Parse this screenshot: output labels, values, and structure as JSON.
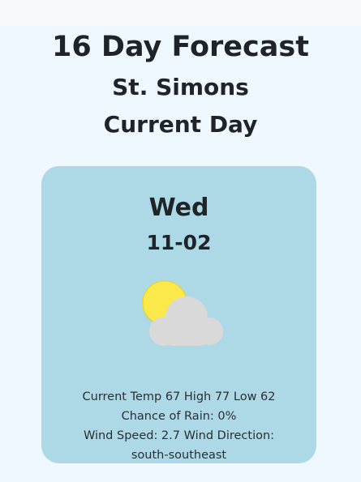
{
  "header": {
    "title": "16 Day Forecast",
    "city": "St. Simons",
    "subtitle": "Current Day"
  },
  "forecast": {
    "day": "Wed",
    "date": "11-02",
    "icon": "partly-cloudy-icon",
    "temp_line": "Current Temp 67 High 77 Low 62",
    "rain_line": "Chance of Rain: 0%",
    "wind_speed_line": "Wind Speed: 2.7 Wind Direction:",
    "wind_direction": "south-southeast"
  },
  "colors": {
    "background": "#f0f8ff",
    "card": "#add8e6",
    "sun": "#fbe84a",
    "cloud": "#d9d9d9"
  }
}
